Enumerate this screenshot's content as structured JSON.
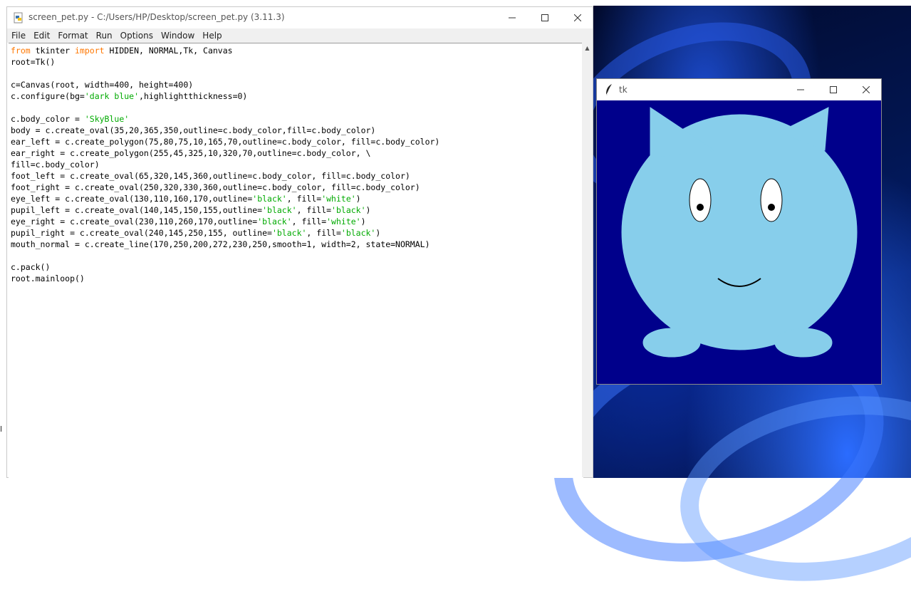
{
  "editor_window": {
    "title": "screen_pet.py - C:/Users/HP/Desktop/screen_pet.py (3.11.3)",
    "menu": [
      "File",
      "Edit",
      "Format",
      "Run",
      "Options",
      "Window",
      "Help"
    ],
    "code_lines": [
      [
        {
          "t": "from",
          "c": "kw"
        },
        {
          "t": " tkinter "
        },
        {
          "t": "import",
          "c": "kw"
        },
        {
          "t": " HIDDEN, NORMAL,Tk, Canvas"
        }
      ],
      [
        {
          "t": "root=Tk()"
        }
      ],
      [],
      [
        {
          "t": "c=Canvas(root, width=400, height=400)"
        }
      ],
      [
        {
          "t": "c.configure(bg="
        },
        {
          "t": "'dark blue'",
          "c": "str"
        },
        {
          "t": ",highlightthickness=0)"
        }
      ],
      [],
      [
        {
          "t": "c.body_color = "
        },
        {
          "t": "'SkyBlue'",
          "c": "str"
        }
      ],
      [
        {
          "t": "body = c.create_oval(35,20,365,350,outline=c.body_color,fill=c.body_color)"
        }
      ],
      [
        {
          "t": "ear_left = c.create_polygon(75,80,75,10,165,70,outline=c.body_color, fill=c.body_color)"
        }
      ],
      [
        {
          "t": "ear_right = c.create_polygon(255,45,325,10,320,70,outline=c.body_color, \\"
        }
      ],
      [
        {
          "t": "fill=c.body_color)"
        }
      ],
      [
        {
          "t": "foot_left = c.create_oval(65,320,145,360,outline=c.body_color, fill=c.body_color)"
        }
      ],
      [
        {
          "t": "foot_right = c.create_oval(250,320,330,360,outline=c.body_color, fill=c.body_color)"
        }
      ],
      [
        {
          "t": "eye_left = c.create_oval(130,110,160,170,outline="
        },
        {
          "t": "'black'",
          "c": "str"
        },
        {
          "t": ", fill="
        },
        {
          "t": "'white'",
          "c": "str"
        },
        {
          "t": ")"
        }
      ],
      [
        {
          "t": "pupil_left = c.create_oval(140,145,150,155,outline="
        },
        {
          "t": "'black'",
          "c": "str"
        },
        {
          "t": ", fill="
        },
        {
          "t": "'black'",
          "c": "str"
        },
        {
          "t": ")"
        }
      ],
      [
        {
          "t": "eye_right = c.create_oval(230,110,260,170,outline="
        },
        {
          "t": "'black'",
          "c": "str"
        },
        {
          "t": ", fill="
        },
        {
          "t": "'white'",
          "c": "str"
        },
        {
          "t": ")"
        }
      ],
      [
        {
          "t": "pupil_right = c.create_oval(240,145,250,155, outline="
        },
        {
          "t": "'black'",
          "c": "str"
        },
        {
          "t": ", fill="
        },
        {
          "t": "'black'",
          "c": "str"
        },
        {
          "t": ")"
        }
      ],
      [
        {
          "t": "mouth_normal = c.create_line(170,250,200,272,230,250,smooth=1, width=2, state=NORMAL)"
        }
      ],
      [],
      [
        {
          "t": "c.pack()"
        }
      ],
      [
        {
          "t": "root.mainloop()"
        }
      ]
    ]
  },
  "tk_window": {
    "title": "tk",
    "canvas_bg": "#00008b",
    "pet_color": "#87ceeb"
  },
  "desktop": {
    "left_edge_text": "l"
  },
  "colors": {
    "keyword": "#ff7700",
    "string": "#00aa00"
  }
}
